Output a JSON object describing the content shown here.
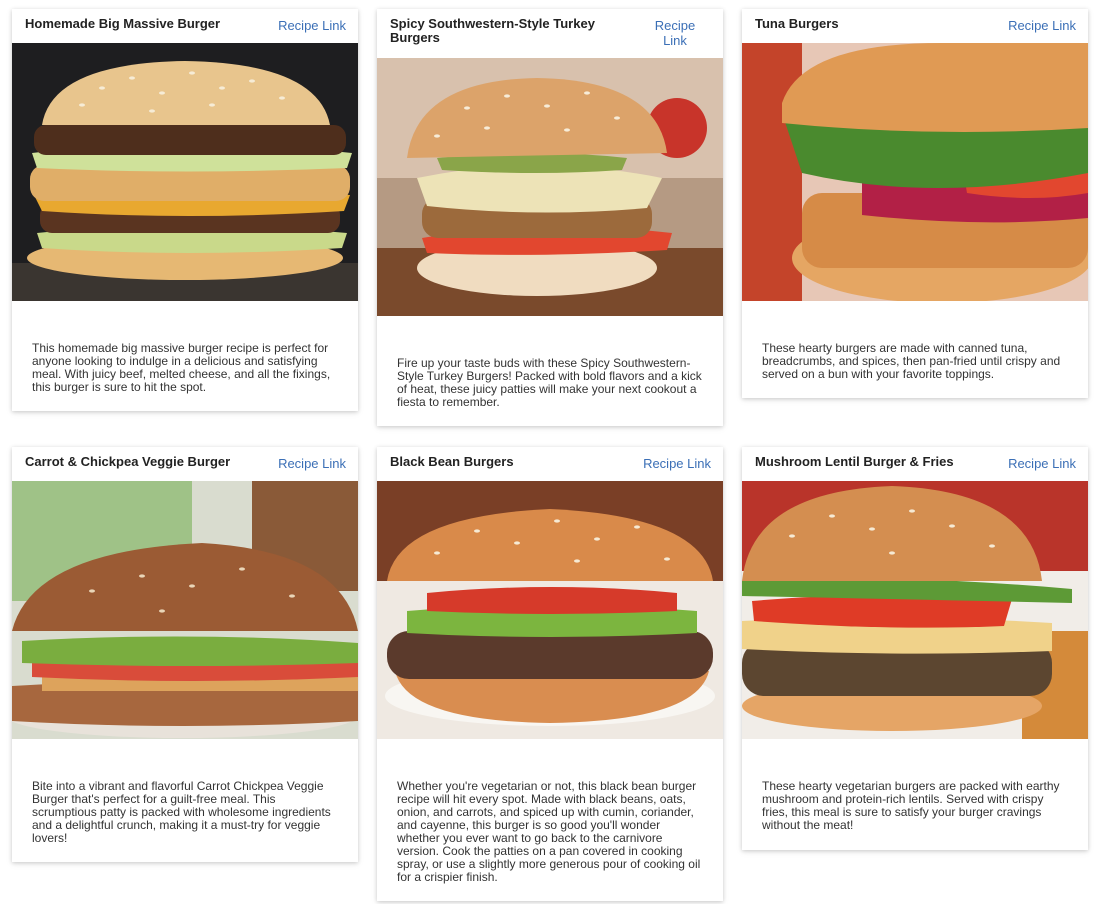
{
  "cards": [
    {
      "title": "Homemade Big Massive Burger",
      "link_label": "Recipe Link",
      "image_icon": "burger-photo",
      "description": "This homemade big massive burger recipe is perfect for anyone looking to indulge in a delicious and satisfying meal. With juicy beef, melted cheese, and all the fixings, this burger is sure to hit the spot."
    },
    {
      "title": "Spicy Southwestern-Style Turkey Burgers",
      "link_label": "Recipe Link",
      "image_icon": "burger-photo",
      "description": "Fire up your taste buds with these Spicy Southwestern-Style Turkey Burgers! Packed with bold flavors and a kick of heat, these juicy patties will make your next cookout a fiesta to remember."
    },
    {
      "title": "Tuna Burgers",
      "link_label": "Recipe Link",
      "image_icon": "burger-photo",
      "description": "These hearty burgers are made with canned tuna, breadcrumbs, and spices, then pan-fried until crispy and served on a bun with your favorite toppings."
    },
    {
      "title": "Carrot & Chickpea Veggie Burger",
      "link_label": "Recipe Link",
      "image_icon": "burger-photo",
      "description": "Bite into a vibrant and flavorful Carrot Chickpea Veggie Burger that's perfect for a guilt-free meal. This scrumptious patty is packed with wholesome ingredients and a delightful crunch, making it a must-try for veggie lovers!"
    },
    {
      "title": "Black Bean Burgers",
      "link_label": "Recipe Link",
      "image_icon": "burger-photo",
      "description": "Whether you're vegetarian or not, this black bean burger recipe will hit every spot. Made with black beans, oats, onion, and carrots, and spiced up with cumin, coriander, and cayenne, this burger is so good you'll wonder whether you ever want to go back to the carnivore version. Cook the patties on a pan covered in cooking spray, or use a slightly more generous pour of cooking oil for a crispier finish."
    },
    {
      "title": "Mushroom Lentil Burger & Fries",
      "link_label": "Recipe Link",
      "image_icon": "burger-photo",
      "description": "These hearty vegetarian burgers are packed with earthy mushroom and protein-rich lentils. Served with crispy fries, this meal is sure to satisfy your burger cravings without the meat!"
    }
  ],
  "colors": {
    "link": "#3b6fb6",
    "title": "#222222",
    "text": "#333333"
  }
}
